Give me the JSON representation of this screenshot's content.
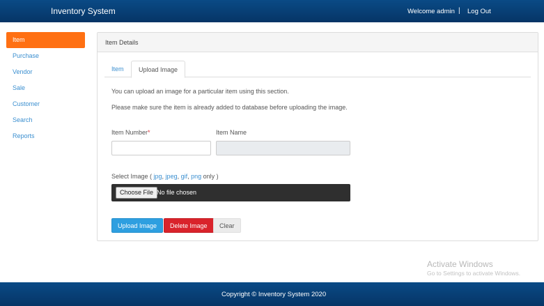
{
  "header": {
    "brand": "Inventory System",
    "welcome": "Welcome admin",
    "separator": "|",
    "logout": "Log Out"
  },
  "sidebar": {
    "items": [
      {
        "label": "Item",
        "active": true
      },
      {
        "label": "Purchase"
      },
      {
        "label": "Vendor"
      },
      {
        "label": "Sale"
      },
      {
        "label": "Customer"
      },
      {
        "label": "Search"
      },
      {
        "label": "Reports"
      }
    ]
  },
  "panel": {
    "title": "Item Details",
    "tabs": [
      {
        "label": "Item"
      },
      {
        "label": "Upload Image",
        "active": true
      }
    ],
    "info_line_1": "You can upload an image for a particular item using this section.",
    "info_line_2": "Please make sure the item is already added to database before uploading the image.",
    "item_number_label": "Item Number",
    "required_mark": "*",
    "item_number_value": "",
    "item_name_label": "Item Name",
    "item_name_value": "",
    "select_image_prefix": "Select Image ( ",
    "ext_jpg": "jpg",
    "ext_jpeg": "jpeg",
    "ext_gif": "gif",
    "ext_png": "png",
    "comma": ", ",
    "select_image_suffix": " only )",
    "choose_file": "Choose File",
    "no_file": "No file chosen",
    "upload_button": "Upload Image",
    "delete_button": "Delete Image",
    "clear_button": "Clear"
  },
  "watermark": {
    "line1": "Activate Windows",
    "line2": "Go to Settings to activate Windows."
  },
  "footer": {
    "copyright": "Copyright © Inventory System 2020"
  },
  "colors": {
    "header_bg": "#063566",
    "active_orange": "#ff7013",
    "link_blue": "#3b8fd0",
    "upload_blue": "#2e9fe0",
    "delete_red": "#d9232b"
  }
}
